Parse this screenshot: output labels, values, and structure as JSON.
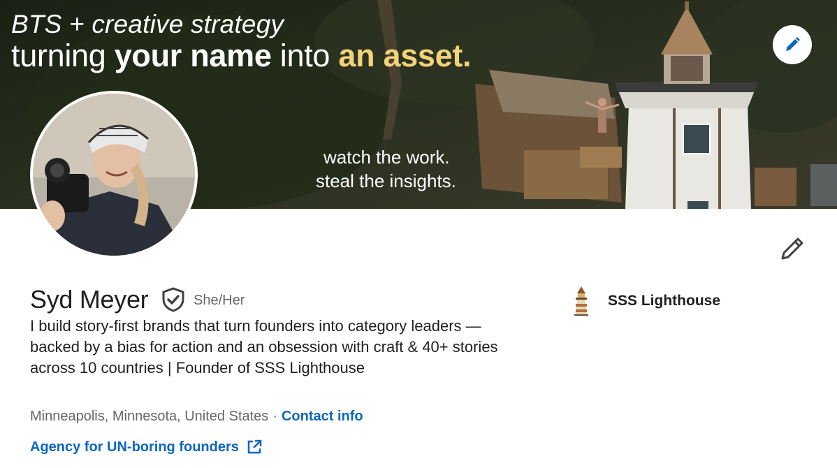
{
  "banner": {
    "line1": "BTS + creative strategy",
    "line2_part1": "turning ",
    "line2_part2": "your name",
    "line2_part3": " into ",
    "line2_accent": "an asset.",
    "tagline1": "watch the work.",
    "tagline2": "steal the insights.",
    "accent_color": "#f2d27a"
  },
  "profile": {
    "name": "Syd Meyer",
    "pronouns": "She/Her",
    "headline": "I build story-first brands that turn founders into category leaders — backed by a bias for action and an obsession with craft & 40+ stories across 10 countries | Founder of SSS Lighthouse",
    "location": "Minneapolis, Minnesota, United States",
    "separator": "·",
    "contact_label": "Contact info",
    "website_label": "Agency for UN-boring founders"
  },
  "company": {
    "name": "SSS Lighthouse"
  },
  "icons": {
    "banner_edit": "pencil-icon",
    "profile_edit": "pencil-icon",
    "verified": "verified-shield-icon",
    "external": "external-link-icon",
    "company_logo": "lighthouse-icon"
  },
  "colors": {
    "link": "#0a66c2",
    "text": "#1f1f1f",
    "muted": "#666666"
  }
}
